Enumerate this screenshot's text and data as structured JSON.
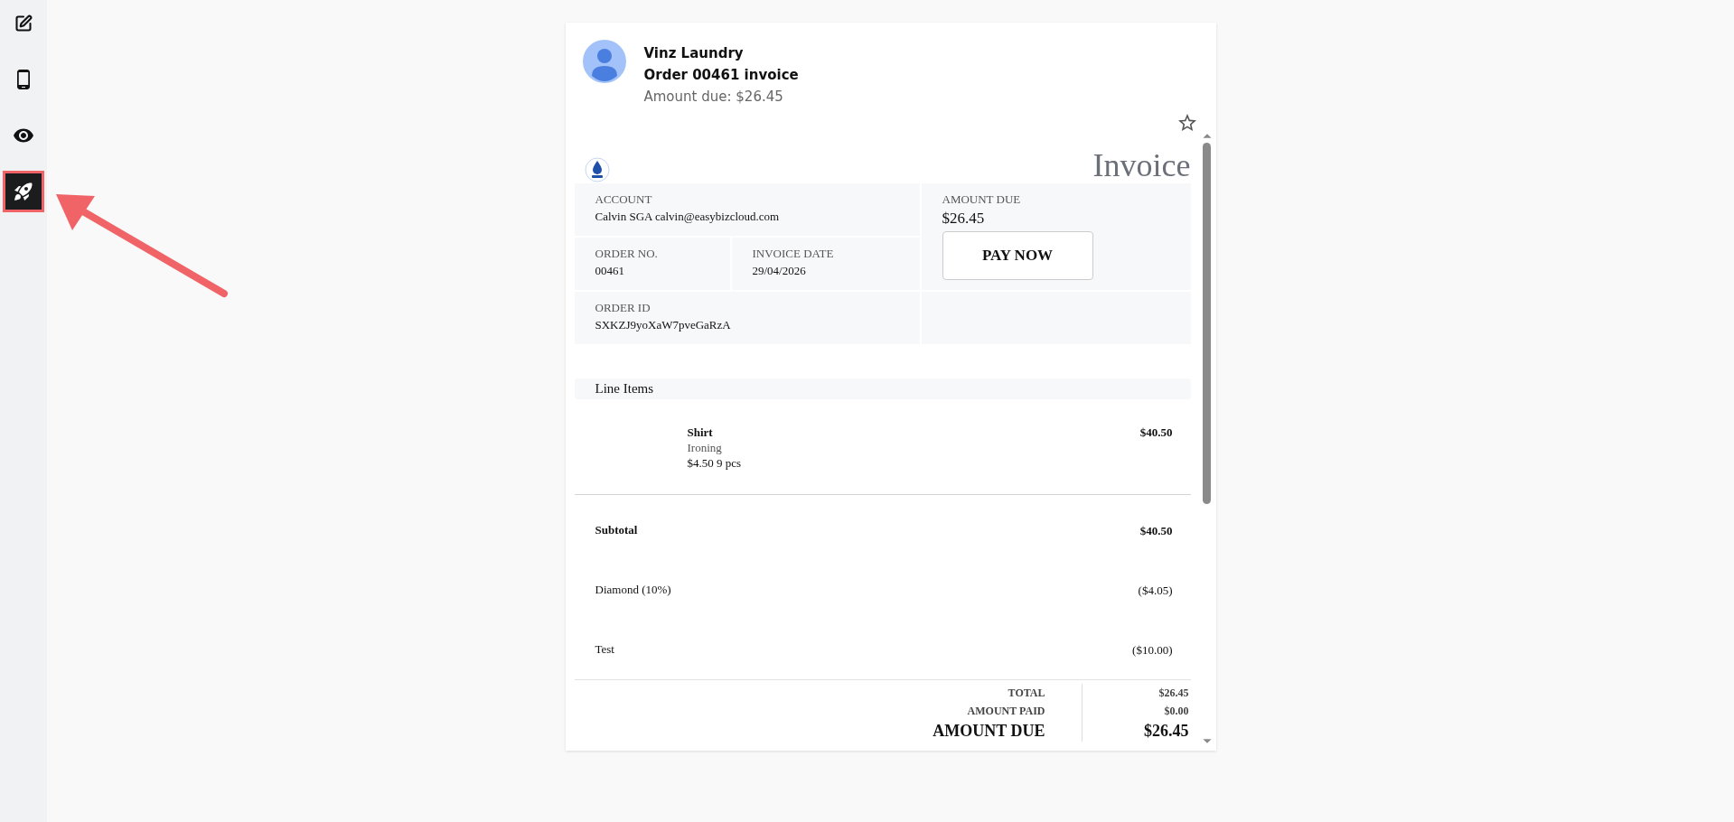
{
  "sidebar": {
    "items": [
      {
        "kind": "edit",
        "selected": false
      },
      {
        "kind": "phone",
        "selected": false
      },
      {
        "kind": "eye",
        "selected": false
      },
      {
        "kind": "rocket",
        "selected": true
      }
    ]
  },
  "annotation": {
    "kind": "arrow"
  },
  "email": {
    "sender": "Vinz Laundry",
    "subject": "Order 00461 invoice",
    "summary": "Amount due: $26.45",
    "starred": false
  },
  "invoice": {
    "title": "Invoice",
    "account": {
      "label": "ACCOUNT",
      "value": "Calvin SGA calvin@easybizcloud.com"
    },
    "order_no": {
      "label": "ORDER NO.",
      "value": "00461"
    },
    "invoice_date": {
      "label": "INVOICE DATE",
      "value": "29/04/2026"
    },
    "order_id": {
      "label": "ORDER ID",
      "value": "SXKZJ9yoXaW7pveGaRzA"
    },
    "amount_due": {
      "label": "AMOUNT DUE",
      "value": "$26.45"
    },
    "pay_button": "PAY NOW",
    "line_items_heading": "Line Items",
    "line_items": [
      {
        "name": "Shirt",
        "service": "Ironing",
        "quantity": "$4.50 9 pcs",
        "amount": "$40.50"
      }
    ],
    "summary": [
      {
        "kind": "subtotal",
        "label": "Subtotal",
        "amount": "$40.50"
      },
      {
        "kind": "discount",
        "label": "Diamond (10%)",
        "amount": "($4.05)"
      },
      {
        "kind": "discount",
        "label": "Test",
        "amount": "($10.00)"
      }
    ],
    "totals": [
      {
        "kind": "normal",
        "label": "TOTAL",
        "amount": "$26.45"
      },
      {
        "kind": "normal",
        "label": "AMOUNT PAID",
        "amount": "$0.00"
      },
      {
        "kind": "grand",
        "label": "AMOUNT DUE",
        "amount": "$26.45"
      }
    ]
  }
}
